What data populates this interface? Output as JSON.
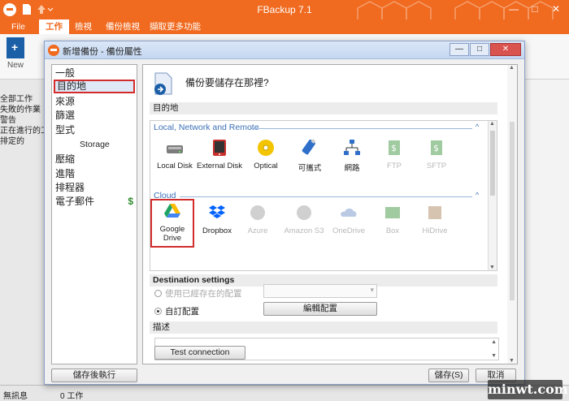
{
  "app": {
    "title": "FBackup 7.1",
    "menu": [
      {
        "label": "File",
        "active": false
      },
      {
        "label": "工作",
        "active": true
      },
      {
        "label": "檢視",
        "active": false
      },
      {
        "label": "備份檢視",
        "active": false
      },
      {
        "label": "擷取更多功能",
        "active": false
      }
    ],
    "ribbon_new_label": "New",
    "window_controls": [
      "—",
      "□",
      "✕"
    ],
    "left_list": [
      "全部工作",
      "失敗的作業",
      "警告",
      "正在進行的工作",
      "排定的"
    ],
    "status_left": "無訊息",
    "status_count": "0 工作"
  },
  "dialog": {
    "title": "新增備份 - 備份屬性",
    "controls": [
      "—",
      "□",
      "✕"
    ],
    "nav": [
      {
        "label": "一般",
        "selected": false,
        "sub": false,
        "paid": false
      },
      {
        "label": "目的地",
        "selected": true,
        "sub": false,
        "paid": false
      },
      {
        "label": "來源",
        "selected": false,
        "sub": false,
        "paid": false
      },
      {
        "label": "篩選",
        "selected": false,
        "sub": false,
        "paid": false
      },
      {
        "label": "型式",
        "selected": false,
        "sub": false,
        "paid": false
      },
      {
        "label": "Storage",
        "selected": false,
        "sub": true,
        "paid": false
      },
      {
        "label": "壓縮",
        "selected": false,
        "sub": false,
        "paid": false
      },
      {
        "label": "進階",
        "selected": false,
        "sub": false,
        "paid": false
      },
      {
        "label": "排程器",
        "selected": false,
        "sub": false,
        "paid": false
      },
      {
        "label": "電子郵件",
        "selected": false,
        "sub": false,
        "paid": true
      }
    ],
    "dollar_sign": "$",
    "question": "備份要儲存在那裡?",
    "destination_header": "目的地",
    "group_local": "Local, Network and Remote",
    "group_cloud": "Cloud",
    "collapse_caret": "^",
    "local_items": [
      {
        "label": "Local Disk",
        "icon": "local-disk-icon",
        "enabled": true
      },
      {
        "label": "External Disk",
        "icon": "external-disk-icon",
        "enabled": true
      },
      {
        "label": "Optical",
        "icon": "optical-disc-icon",
        "enabled": true
      },
      {
        "label": "可攜式",
        "icon": "usb-drive-icon",
        "enabled": true
      },
      {
        "label": "網路",
        "icon": "network-icon",
        "enabled": true
      },
      {
        "label": "FTP",
        "icon": "ftp-icon",
        "enabled": false
      },
      {
        "label": "SFTP",
        "icon": "sftp-icon",
        "enabled": false
      }
    ],
    "cloud_items": [
      {
        "label": "Google\nDrive",
        "icon": "google-drive-icon",
        "enabled": true,
        "selected": true
      },
      {
        "label": "Dropbox",
        "icon": "dropbox-icon",
        "enabled": true,
        "selected": false
      },
      {
        "label": "Azure",
        "icon": "azure-icon",
        "enabled": false,
        "selected": false
      },
      {
        "label": "Amazon S3",
        "icon": "amazon-s3-icon",
        "enabled": false,
        "selected": false
      },
      {
        "label": "OneDrive",
        "icon": "onedrive-icon",
        "enabled": false,
        "selected": false
      },
      {
        "label": "Box",
        "icon": "box-icon",
        "enabled": false,
        "selected": false
      },
      {
        "label": "HiDrive",
        "icon": "hidrive-icon",
        "enabled": false,
        "selected": false
      }
    ],
    "dest_settings_header": "Destination settings",
    "radio_existing": "使用已經存在的配置",
    "radio_custom": "自訂配置",
    "edit_config_button": "編輯配置",
    "description_header": "描述",
    "test_connection_button": "Test connection",
    "save_run_button": "儲存後執行",
    "save_button": "儲存(S)",
    "cancel_button": "取消"
  },
  "watermark": "minwt.com",
  "colors": {
    "brand_orange": "#f06a1f",
    "highlight_red": "#d32c2c",
    "group_blue": "#3b6fb7",
    "paid_green": "#2e8b2e"
  }
}
